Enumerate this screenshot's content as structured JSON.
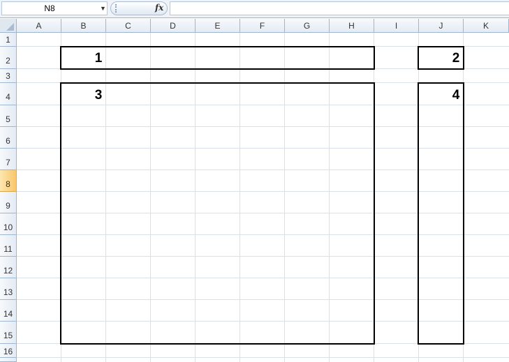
{
  "formula_bar": {
    "name_box": "N8",
    "fx_label": "fx",
    "formula": ""
  },
  "columns": [
    "A",
    "B",
    "C",
    "D",
    "E",
    "F",
    "G",
    "H",
    "I",
    "J",
    "K"
  ],
  "rows": [
    "1",
    "2",
    "3",
    "4",
    "5",
    "6",
    "7",
    "8",
    "9",
    "10",
    "11",
    "12",
    "13",
    "14",
    "15",
    "16"
  ],
  "active_row": "8",
  "boxes": [
    {
      "label": "1"
    },
    {
      "label": "2"
    },
    {
      "label": "3"
    },
    {
      "label": "4"
    }
  ]
}
